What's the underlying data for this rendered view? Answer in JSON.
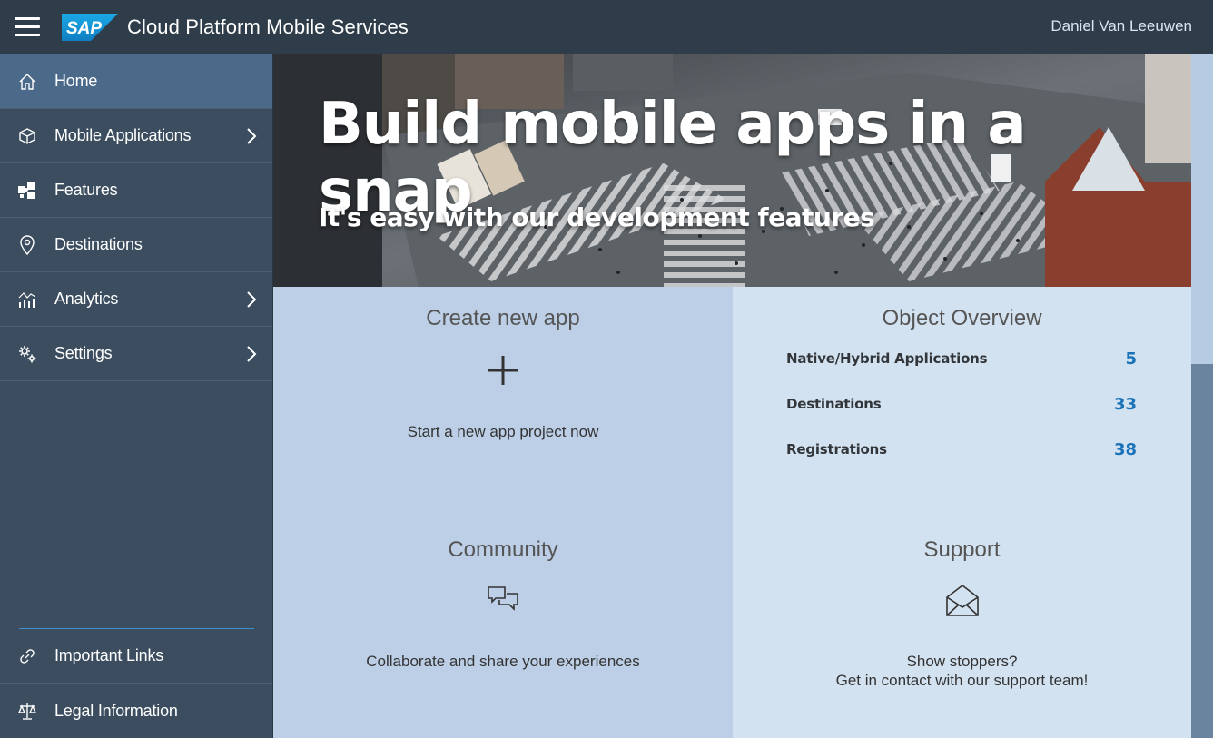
{
  "shell": {
    "brand": "SAP",
    "title": "Cloud Platform Mobile Services",
    "user": "Daniel Van Leeuwen"
  },
  "sidebar": {
    "items": [
      {
        "label": "Home",
        "icon": "home-icon",
        "active": true,
        "has_children": false
      },
      {
        "label": "Mobile Applications",
        "icon": "cube-icon",
        "active": false,
        "has_children": true
      },
      {
        "label": "Features",
        "icon": "puzzle-icon",
        "active": false,
        "has_children": false
      },
      {
        "label": "Destinations",
        "icon": "location-pin-icon",
        "active": false,
        "has_children": false
      },
      {
        "label": "Analytics",
        "icon": "analytics-icon",
        "active": false,
        "has_children": true
      },
      {
        "label": "Settings",
        "icon": "gears-icon",
        "active": false,
        "has_children": true
      }
    ],
    "bottom_items": [
      {
        "label": "Important Links",
        "icon": "link-icon"
      },
      {
        "label": "Legal Information",
        "icon": "scales-icon"
      }
    ]
  },
  "hero": {
    "title": "Build mobile apps in a snap",
    "subtitle": "It's easy with our development features"
  },
  "tiles": {
    "create": {
      "title": "Create new app",
      "icon": "plus-icon",
      "description": "Start a new app project now"
    },
    "overview": {
      "title": "Object Overview",
      "rows": [
        {
          "label": "Native/Hybrid Applications",
          "value": "5"
        },
        {
          "label": "Destinations",
          "value": "33"
        },
        {
          "label": "Registrations",
          "value": "38"
        }
      ]
    },
    "community": {
      "title": "Community",
      "icon": "discussion-icon",
      "description": "Collaborate and share your experiences"
    },
    "support": {
      "title": "Support",
      "icon": "envelope-icon",
      "description_line1": "Show stoppers?",
      "description_line2": "Get in contact with our support team!"
    }
  },
  "colors": {
    "shellbar": "#2f3c49",
    "sidebar": "#3b4d5f",
    "sidebar_active": "#4b6a8a",
    "tile_dark": "#bccfe6",
    "tile_light": "#d3e2f0",
    "accent_value": "#1a72b8",
    "sap_logo_blue": "#1a9ee0"
  }
}
